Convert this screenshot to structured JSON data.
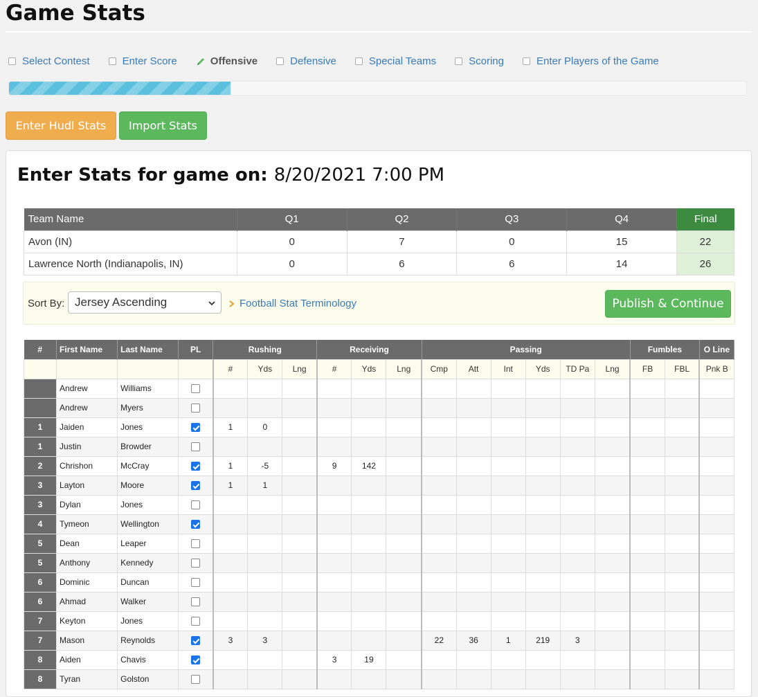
{
  "page": {
    "title": "Game Stats"
  },
  "steps": [
    {
      "label": "Select Contest",
      "state": "unchecked"
    },
    {
      "label": "Enter Score",
      "state": "unchecked"
    },
    {
      "label": "Offensive",
      "state": "active"
    },
    {
      "label": "Defensive",
      "state": "unchecked"
    },
    {
      "label": "Special Teams",
      "state": "unchecked"
    },
    {
      "label": "Scoring",
      "state": "unchecked"
    },
    {
      "label": "Enter Players of the Game",
      "state": "unchecked"
    }
  ],
  "progress": {
    "fraction": 0.3
  },
  "actions": {
    "hudl_label": "Enter Hudl Stats",
    "import_label": "Import Stats"
  },
  "game": {
    "heading_prefix": "Enter Stats for game on:",
    "date": "8/20/2021 7:00 PM"
  },
  "score_table": {
    "headers": [
      "Team Name",
      "Q1",
      "Q2",
      "Q3",
      "Q4",
      "Final"
    ],
    "rows": [
      {
        "team": "Avon (IN)",
        "q1": "0",
        "q2": "7",
        "q3": "0",
        "q4": "15",
        "final": "22"
      },
      {
        "team": "Lawrence North (Indianapolis, IN)",
        "q1": "0",
        "q2": "6",
        "q3": "6",
        "q4": "14",
        "final": "26"
      }
    ]
  },
  "sort": {
    "label": "Sort By:",
    "selected": "Jersey Ascending",
    "terms_link": "Football Stat Terminology",
    "publish_label": "Publish & Continue"
  },
  "stats_table": {
    "group_headers": {
      "num": "#",
      "first": "First Name",
      "last": "Last Name",
      "pl": "PL",
      "rushing": "Rushing",
      "receiving": "Receiving",
      "passing": "Passing",
      "fumbles": "Fumbles",
      "oline": "O Line"
    },
    "sub_headers": [
      "#",
      "Yds",
      "Lng",
      "#",
      "Yds",
      "Lng",
      "Cmp",
      "Att",
      "Int",
      "Yds",
      "TD Pa",
      "Lng",
      "FB",
      "FBL",
      "Pnk B"
    ],
    "players": [
      {
        "num": "",
        "first": "Andrew",
        "last": "Williams",
        "pl": false,
        "stats": [
          "",
          "",
          "",
          "",
          "",
          "",
          "",
          "",
          "",
          "",
          "",
          "",
          "",
          "",
          ""
        ]
      },
      {
        "num": "",
        "first": "Andrew",
        "last": "Myers",
        "pl": false,
        "stats": [
          "",
          "",
          "",
          "",
          "",
          "",
          "",
          "",
          "",
          "",
          "",
          "",
          "",
          "",
          ""
        ]
      },
      {
        "num": "1",
        "first": "Jaiden",
        "last": "Jones",
        "pl": true,
        "stats": [
          "1",
          "0",
          "",
          "",
          "",
          "",
          "",
          "",
          "",
          "",
          "",
          "",
          "",
          "",
          ""
        ]
      },
      {
        "num": "1",
        "first": "Justin",
        "last": "Browder",
        "pl": false,
        "stats": [
          "",
          "",
          "",
          "",
          "",
          "",
          "",
          "",
          "",
          "",
          "",
          "",
          "",
          "",
          ""
        ]
      },
      {
        "num": "2",
        "first": "Chrishon",
        "last": "McCray",
        "pl": true,
        "stats": [
          "1",
          "-5",
          "",
          "9",
          "142",
          "",
          "",
          "",
          "",
          "",
          "",
          "",
          "",
          "",
          ""
        ]
      },
      {
        "num": "3",
        "first": "Layton",
        "last": "Moore",
        "pl": true,
        "stats": [
          "1",
          "1",
          "",
          "",
          "",
          "",
          "",
          "",
          "",
          "",
          "",
          "",
          "",
          "",
          ""
        ]
      },
      {
        "num": "3",
        "first": "Dylan",
        "last": "Jones",
        "pl": false,
        "stats": [
          "",
          "",
          "",
          "",
          "",
          "",
          "",
          "",
          "",
          "",
          "",
          "",
          "",
          "",
          ""
        ]
      },
      {
        "num": "4",
        "first": "Tymeon",
        "last": "Wellington",
        "pl": true,
        "stats": [
          "",
          "",
          "",
          "",
          "",
          "",
          "",
          "",
          "",
          "",
          "",
          "",
          "",
          "",
          ""
        ]
      },
      {
        "num": "5",
        "first": "Dean",
        "last": "Leaper",
        "pl": false,
        "stats": [
          "",
          "",
          "",
          "",
          "",
          "",
          "",
          "",
          "",
          "",
          "",
          "",
          "",
          "",
          ""
        ]
      },
      {
        "num": "5",
        "first": "Anthony",
        "last": "Kennedy",
        "pl": false,
        "stats": [
          "",
          "",
          "",
          "",
          "",
          "",
          "",
          "",
          "",
          "",
          "",
          "",
          "",
          "",
          ""
        ]
      },
      {
        "num": "6",
        "first": "Dominic",
        "last": "Duncan",
        "pl": false,
        "stats": [
          "",
          "",
          "",
          "",
          "",
          "",
          "",
          "",
          "",
          "",
          "",
          "",
          "",
          "",
          ""
        ]
      },
      {
        "num": "6",
        "first": "Ahmad",
        "last": "Walker",
        "pl": false,
        "stats": [
          "",
          "",
          "",
          "",
          "",
          "",
          "",
          "",
          "",
          "",
          "",
          "",
          "",
          "",
          ""
        ]
      },
      {
        "num": "7",
        "first": "Keyton",
        "last": "Jones",
        "pl": false,
        "stats": [
          "",
          "",
          "",
          "",
          "",
          "",
          "",
          "",
          "",
          "",
          "",
          "",
          "",
          "",
          ""
        ]
      },
      {
        "num": "7",
        "first": "Mason",
        "last": "Reynolds",
        "pl": true,
        "stats": [
          "3",
          "3",
          "",
          "",
          "",
          "",
          "22",
          "36",
          "1",
          "219",
          "3",
          "",
          "",
          "",
          ""
        ]
      },
      {
        "num": "8",
        "first": "Aiden",
        "last": "Chavis",
        "pl": true,
        "stats": [
          "",
          "",
          "",
          "3",
          "19",
          "",
          "",
          "",
          "",
          "",
          "",
          "",
          "",
          "",
          ""
        ]
      },
      {
        "num": "8",
        "first": "Tyran",
        "last": "Golston",
        "pl": false,
        "stats": [
          "",
          "",
          "",
          "",
          "",
          "",
          "",
          "",
          "",
          "",
          "",
          "",
          "",
          "",
          ""
        ]
      }
    ]
  },
  "colors": {
    "accent_link": "#3a7ab5",
    "orange_button": "#f0ad4e",
    "green_button": "#5cb85c",
    "header_gray": "#6b6b6b",
    "final_green": "#3d8b40",
    "progress_blue": "#5bc0de"
  },
  "icons": {
    "active_step": "pencil-icon",
    "select_caret": "chevron-down-icon",
    "link_chevron": "chevron-right-icon"
  }
}
